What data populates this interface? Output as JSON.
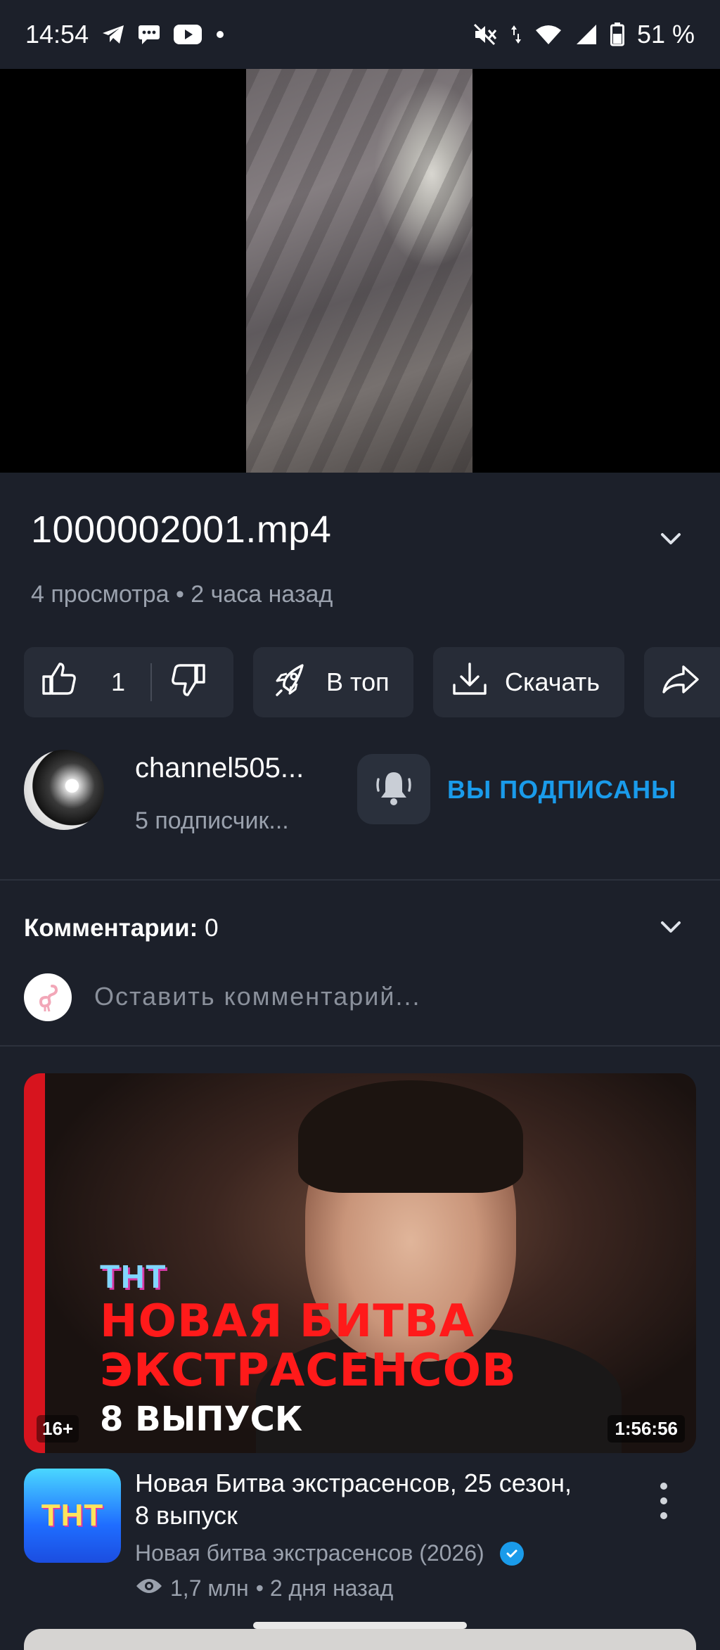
{
  "status_bar": {
    "time": "14:54",
    "battery": "51 %",
    "icons_left": [
      "telegram-icon",
      "message-icon",
      "youtube-icon",
      "dot-icon"
    ],
    "icons_right": [
      "mute-icon",
      "data-arrows-icon",
      "wifi-icon",
      "signal-icon",
      "battery-icon"
    ]
  },
  "video": {
    "title": "1000002001.mp4",
    "meta": "4 просмотра • 2 часа назад"
  },
  "actions": {
    "like_count": "1",
    "top_label": "В топ",
    "download_label": "Скачать"
  },
  "channel": {
    "name": "channel505...",
    "subscribers": "5 подписчик...",
    "subscribed_label": "ВЫ ПОДПИСАНЫ"
  },
  "comments": {
    "label": "Комментарии:",
    "count": "0",
    "placeholder": "Оставить комментарий..."
  },
  "recommendation": {
    "thumb_logo": "ТНТ",
    "thumb_line1": "НОВАЯ БИТВА",
    "thumb_line2": "ЭКСТРАСЕНСОВ",
    "thumb_line3": "8 ВЫПУСК",
    "age_rating": "16+",
    "duration": "1:56:56",
    "avatar_logo": "ТНТ",
    "title": "Новая Битва экстрасенсов, 25 сезон, 8 выпуск",
    "channel": "Новая битва экстрасенсов (2026)",
    "views": "1,7 млн",
    "age": "• 2 дня назад"
  },
  "colors": {
    "background": "#1c202a",
    "accent": "#1a9bea",
    "pill": "#272c37"
  }
}
